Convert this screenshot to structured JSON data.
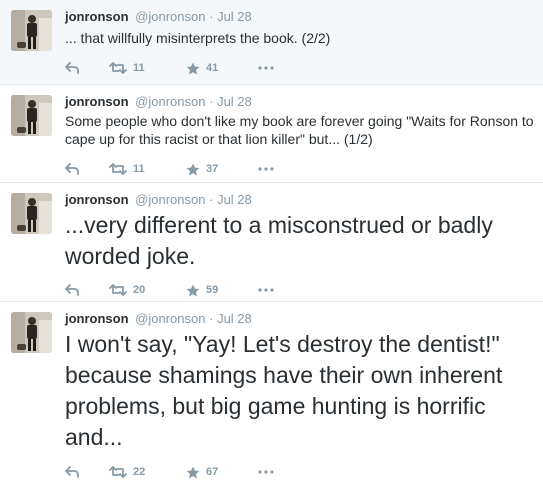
{
  "colors": {
    "meta": "#8899a6",
    "text": "#292f33",
    "highlight_bg": "#f5f8fa",
    "divider": "#e1e8ed"
  },
  "icons": {
    "reply": "reply-icon",
    "retweet": "retweet-icon",
    "favorite": "star-icon",
    "more": "more-icon"
  },
  "tweets": [
    {
      "name": "jonronson",
      "handle": "@jonronson",
      "separator": "·",
      "time": "Jul 28",
      "text": "... that willfully misinterprets the book. (2/2)",
      "retweets": "11",
      "favorites": "41"
    },
    {
      "name": "jonronson",
      "handle": "@jonronson",
      "separator": "·",
      "time": "Jul 28",
      "text": "Some people who don't like my book are forever going \"Waits for Ronson to cape up for this racist or that lion killer\" but... (1/2)",
      "retweets": "11",
      "favorites": "37"
    },
    {
      "name": "jonronson",
      "handle": "@jonronson",
      "separator": "·",
      "time": "Jul 28",
      "text": "...very different to a misconstrued or badly worded joke.",
      "retweets": "20",
      "favorites": "59"
    },
    {
      "name": "jonronson",
      "handle": "@jonronson",
      "separator": "·",
      "time": "Jul 28",
      "text": "I won't say, \"Yay! Let's destroy the dentist!\" because shamings have their own inherent problems, but big game hunting is horrific and...",
      "retweets": "22",
      "favorites": "67"
    }
  ]
}
